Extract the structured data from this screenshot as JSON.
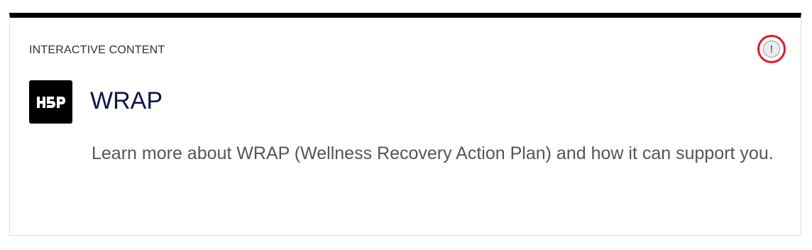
{
  "card": {
    "category_label": "INTERACTIVE CONTENT",
    "logo_text": "H5P",
    "title": "WRAP",
    "description": "Learn more about WRAP (Wellness Recovery Action Plan) and how it can support you.",
    "alert_icon": "exclamation-circle-icon",
    "alert_symbol": "!"
  },
  "colors": {
    "top_border": "#000000",
    "title": "#10124a",
    "alert_highlight": "#e31b23",
    "description": "#555555"
  }
}
